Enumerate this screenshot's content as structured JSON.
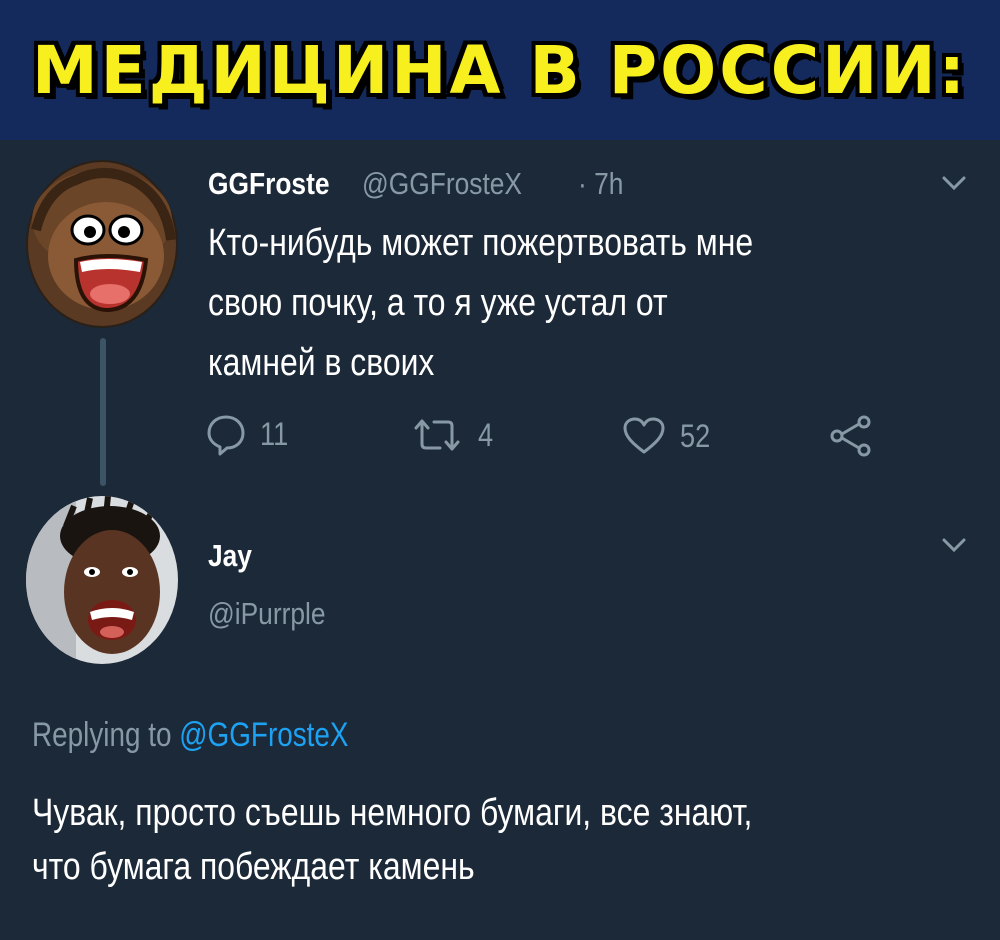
{
  "banner": {
    "title": "МЕДИЦИНА В РОССИИ:"
  },
  "tweet": {
    "name": "GGFroste",
    "handle": "@GGFrosteX",
    "time": "· 7h",
    "lines": [
      "Кто-нибудь может пожертвовать мне",
      "свою почку, а то я  уже устал от",
      "камней в своих"
    ],
    "actions": {
      "replies": "11",
      "retweets": "4",
      "likes": "52"
    }
  },
  "reply": {
    "name": "Jay",
    "handle": "@iPurrple",
    "replying_prefix": "Replying to",
    "replying_mention": "@GGFrosteX",
    "lines": [
      "Чувак, просто съешь немного бумаги, все знают,",
      "что бумага побеждает камень"
    ]
  },
  "colors": {
    "background": "#1c2938",
    "banner": "#142a5c",
    "banner_text": "#f7ef1e",
    "muted": "#8899a6",
    "link": "#1da1f2"
  }
}
